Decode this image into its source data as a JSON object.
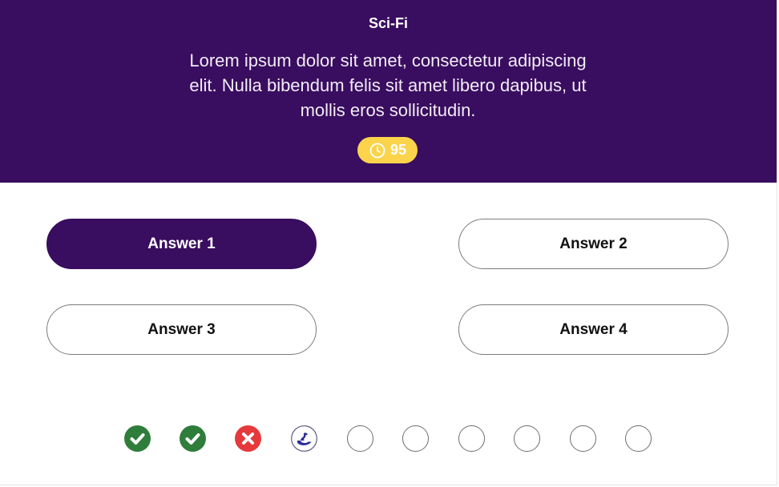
{
  "quiz": {
    "category": "Sci-Fi",
    "question": "Lorem ipsum dolor sit amet, consectetur adipiscing elit. Nulla bibendum felis sit amet libero dapibus, ut mollis eros sollicitudin.",
    "timer": {
      "value": "95",
      "icon": "clock-icon"
    },
    "answers": [
      {
        "label": "Answer 1",
        "selected": true
      },
      {
        "label": "Answer 2",
        "selected": false
      },
      {
        "label": "Answer 3",
        "selected": false
      },
      {
        "label": "Answer 4",
        "selected": false
      }
    ],
    "progress": [
      "correct",
      "correct",
      "wrong",
      "current",
      "pending",
      "pending",
      "pending",
      "pending",
      "pending",
      "pending"
    ]
  },
  "colors": {
    "header_bg": "#390d5f",
    "timer_bg": "#fbd44c",
    "correct": "#2f7d3a",
    "wrong": "#e5393c",
    "current": "#2b2f9c"
  }
}
